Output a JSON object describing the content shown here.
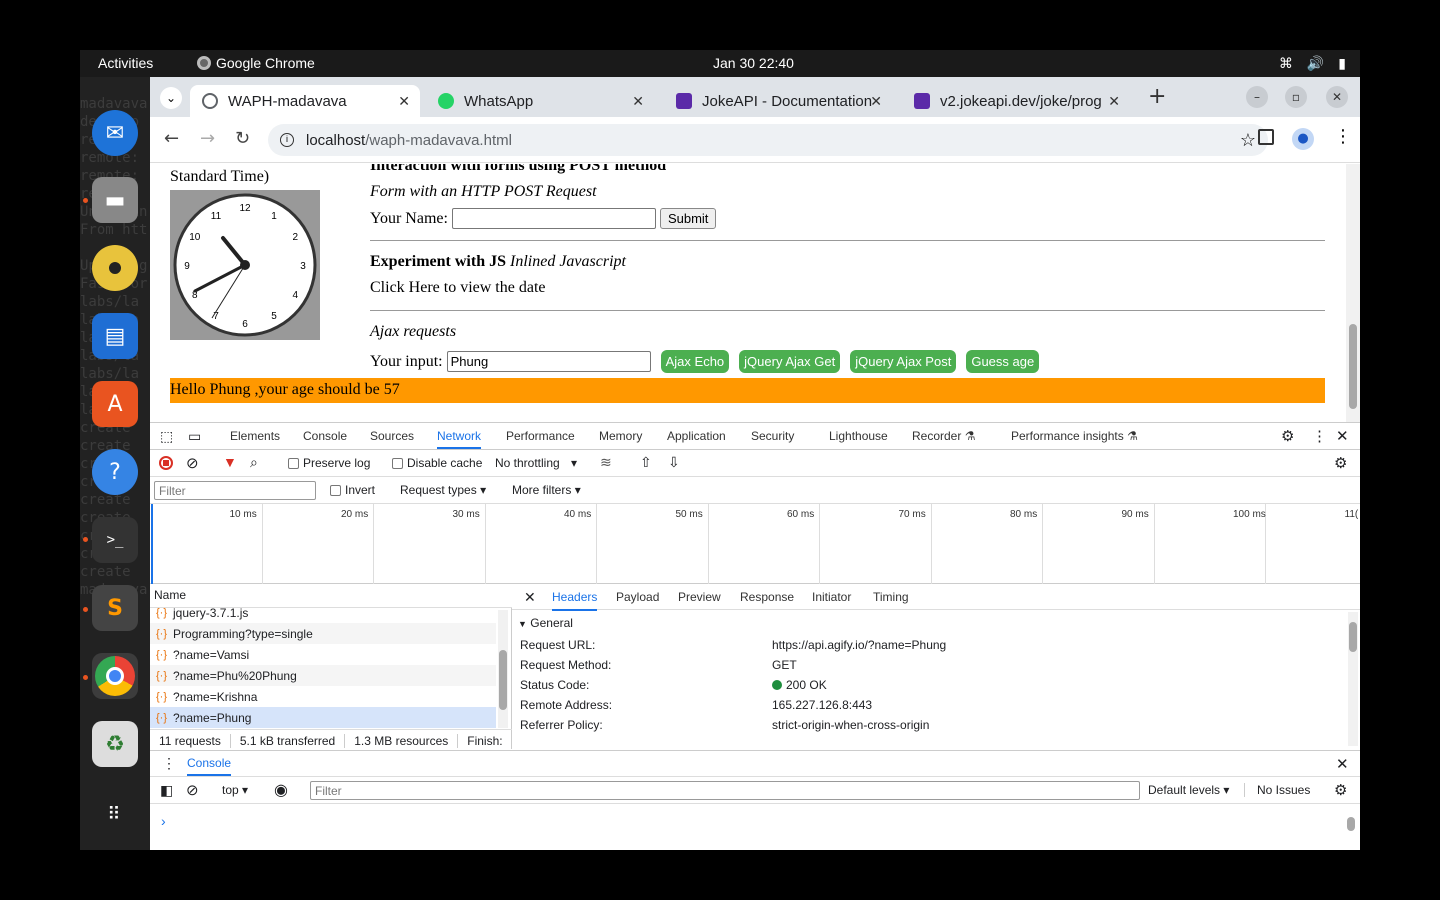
{
  "topbar": {
    "activities": "Activities",
    "app": "Google Chrome",
    "clock": "Jan 30  22:40"
  },
  "terminal_lines": [
    "",
    "madavava",
    "desktop",
    "remote:",
    "remote:",
    "remote:",
    "remote:",
    "Unpackin",
    "From htt",
    "",
    "Updating",
    "Fast-for",
    "labs/la",
    "labs/la",
    "labs/la",
    "labs/la",
    "labs/la",
    "labs/la",
    "labs/la",
    "create",
    "create",
    "create",
    "create",
    "create",
    "create",
    "create",
    "create",
    "create",
    "madavava"
  ],
  "tabs": [
    {
      "title": "WAPH-madavava",
      "active": true,
      "favicon": "globe-icon",
      "favcolor": "#5f6368"
    },
    {
      "title": "WhatsApp",
      "active": false,
      "favicon": "whatsapp-icon",
      "favcolor": "#25d366"
    },
    {
      "title": "JokeAPI - Documentation",
      "active": false,
      "favicon": "jokeapi-icon",
      "favcolor": "#5b2aa8"
    },
    {
      "title": "v2.jokeapi.dev/joke/prog",
      "active": false,
      "favicon": "jokeapi-icon",
      "favcolor": "#5b2aa8"
    }
  ],
  "omnibox": {
    "host": "localhost",
    "path": "/waph-madavava.html"
  },
  "page": {
    "clock_caption": "Standard Time)",
    "forms_heading": "Interaction with forms using POST method",
    "form_subtitle": "Form with an HTTP POST Request",
    "name_label": "Your Name:",
    "name_value": "",
    "submit_label": "Submit",
    "js_heading_bold": "Experiment with JS",
    "js_heading_italic": "Inlined Javascript",
    "click_text": "Click Here to view the date",
    "ajax_title": "Ajax requests",
    "input_label": "Your input:",
    "input_value": "Phung",
    "buttons": [
      "Ajax Echo",
      "jQuery Ajax Get",
      "jQuery Ajax Post",
      "Guess age"
    ],
    "result": "Hello Phung ,your age should be 57",
    "clock_numbers": [
      "12",
      "1",
      "2",
      "3",
      "4",
      "5",
      "6",
      "7",
      "8",
      "9",
      "10",
      "11"
    ]
  },
  "devtools": {
    "tabs": [
      "Elements",
      "Console",
      "Sources",
      "Network",
      "Performance",
      "Memory",
      "Application",
      "Security",
      "Lighthouse",
      "Recorder",
      "Performance insights"
    ],
    "active_tab": "Network",
    "preserve_log": "Preserve log",
    "disable_cache": "Disable cache",
    "throttling": "No throttling",
    "filter_placeholder": "Filter",
    "invert": "Invert",
    "request_types": "Request types",
    "more_filters": "More filters",
    "ticks": [
      "10 ms",
      "20 ms",
      "30 ms",
      "40 ms",
      "50 ms",
      "60 ms",
      "70 ms",
      "80 ms",
      "90 ms",
      "100 ms",
      "11("
    ],
    "name_header": "Name",
    "requests": [
      "jquery-3.7.1.js",
      "Programming?type=single",
      "?name=Vamsi",
      "?name=Phu%20Phung",
      "?name=Krishna",
      "?name=Phung"
    ],
    "selected_request": "?name=Phung",
    "summary": {
      "requests": "11 requests",
      "transferred": "5.1 kB transferred",
      "resources": "1.3 MB resources",
      "finish": "Finish:"
    },
    "detail_tabs": [
      "Headers",
      "Payload",
      "Preview",
      "Response",
      "Initiator",
      "Timing"
    ],
    "active_detail_tab": "Headers",
    "general_label": "General",
    "general": [
      {
        "key": "Request URL:",
        "value": "https://api.agify.io/?name=Phung"
      },
      {
        "key": "Request Method:",
        "value": "GET"
      },
      {
        "key": "Status Code:",
        "value": "200 OK"
      },
      {
        "key": "Remote Address:",
        "value": "165.227.126.8:443"
      },
      {
        "key": "Referrer Policy:",
        "value": "strict-origin-when-cross-origin"
      }
    ],
    "console_tab": "Console",
    "console_context": "top",
    "console_filter": "Filter",
    "default_levels": "Default levels",
    "no_issues": "No Issues"
  }
}
